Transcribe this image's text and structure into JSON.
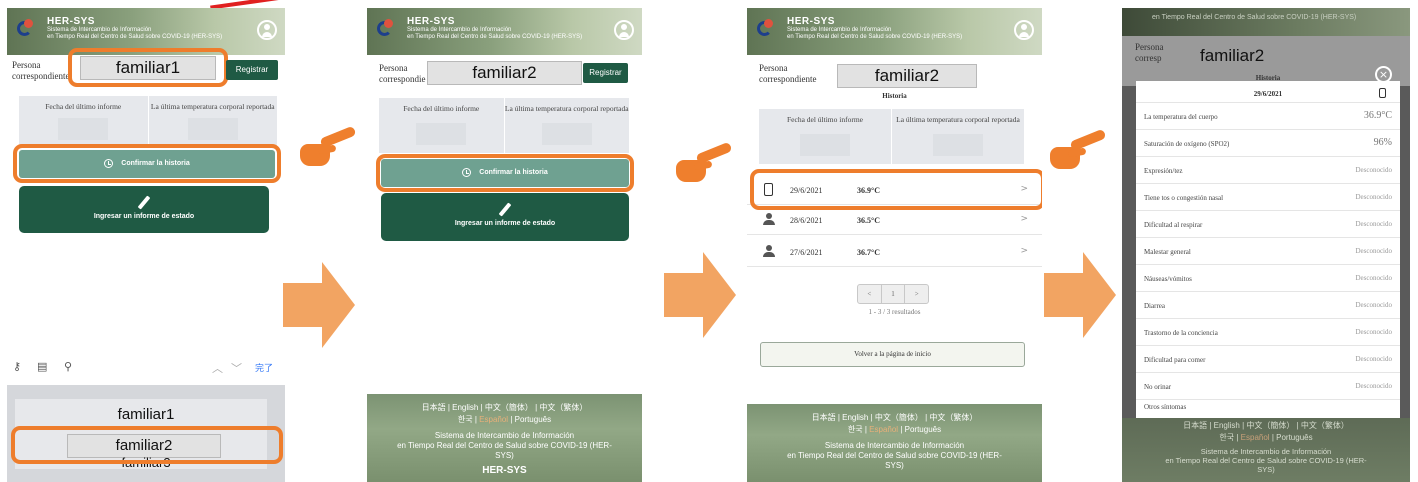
{
  "header": {
    "brand": "HER-SYS",
    "sub1": "Sistema de Intercambio de Información",
    "sub2": "en Tiempo Real del Centro de Salud sobre COVID-19 (HER-SYS)"
  },
  "persona": {
    "label_line1": "Persona",
    "label_line2": "correspondiente",
    "label_clipped": "correspondie",
    "selected_1": "familiar1",
    "selected_2": "familiar2",
    "register": "Registrar"
  },
  "stats": {
    "last_report": "Fecha del último informe",
    "last_temp": "La última temperatura corporal reportada"
  },
  "actions": {
    "confirm_history": "Confirmar la historia",
    "enter_report": "Ingresar un informe de estado"
  },
  "keyboard": {
    "done": "完了",
    "options": [
      "familiar1",
      "familiar2",
      "familiar3"
    ]
  },
  "footer": {
    "langs_line1": "日本語 | English | 中文（簡体） | 中文（繁体）",
    "lang_ko": "한국",
    "lang_es": "Español",
    "lang_pt": "Português",
    "sys_line1": "Sistema de Intercambio de Información",
    "sys_line2": "en Tiempo Real del Centro de Salud sobre COVID-19 (HER-",
    "sys_line3": "SYS)",
    "brand": "HER-SYS"
  },
  "history": {
    "title": "Historia",
    "rows": [
      {
        "date": "29/6/2021",
        "temp": "36.9°C"
      },
      {
        "date": "28/6/2021",
        "temp": "36.5°C"
      },
      {
        "date": "27/6/2021",
        "temp": "36.7°C"
      }
    ],
    "pager": [
      "<",
      "1",
      ">"
    ],
    "results": "1 - 3 / 3 resultados",
    "back_home": "Volver a la página de inicio"
  },
  "detail": {
    "persona_short1": "Persona",
    "persona_short2": "corresp",
    "selected": "familiar2",
    "title": "Historia",
    "date": "29/6/2021",
    "rows": [
      {
        "label": "La temperatura del cuerpo",
        "value": "36.9°C"
      },
      {
        "label": "Saturación de oxígeno (SPO2)",
        "value": "96%"
      },
      {
        "label": "Expresión/tez",
        "value": "Desconocido"
      },
      {
        "label": "Tiene tos o congestión nasal",
        "value": "Desconocido"
      },
      {
        "label": "Dificultad al respirar",
        "value": "Desconocido"
      },
      {
        "label": "Malestar general",
        "value": "Desconocido"
      },
      {
        "label": "Náuseas/vómitos",
        "value": "Desconocido"
      },
      {
        "label": "Diarrea",
        "value": "Desconocido"
      },
      {
        "label": "Trastorno de la conciencia",
        "value": "Desconocido"
      },
      {
        "label": "Dificultad para comer",
        "value": "Desconocido"
      },
      {
        "label": "No orinar",
        "value": "Desconocido"
      },
      {
        "label": "Otros síntomas",
        "value": ""
      }
    ],
    "close": "×"
  },
  "colors": {
    "accent_orange": "#ee7d2c",
    "dark_green": "#1f5a44",
    "light_green": "#6fa191"
  }
}
